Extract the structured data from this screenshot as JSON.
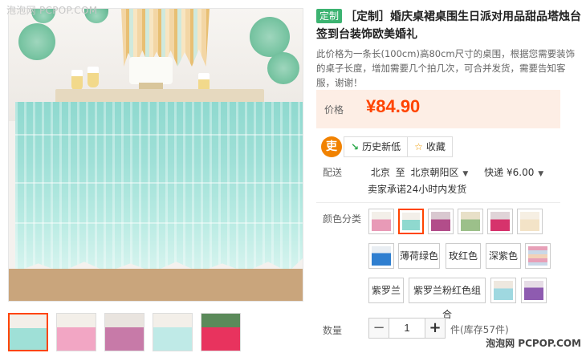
{
  "watermark_top": "泡泡网 PCPOP.COM",
  "watermark_bottom": "泡泡网 PCPOP.COM",
  "product": {
    "tag": "定制",
    "title": "［定制］婚庆桌裙桌围生日派对用品甜品塔烛台签到台装饰欧美婚礼",
    "description": "此价格为一条长(100cm)高80cm尺寸的桌围，根据您需要装饰的桌子长度，增加需要几个拍几次，可合并发货，需要告知客服，谢谢！"
  },
  "price": {
    "label": "价格",
    "value": "¥84.90"
  },
  "actions": {
    "zhi_icon_text": "吏",
    "history_label": "历史新低",
    "favorite_label": "收藏"
  },
  "shipping": {
    "label": "配送",
    "from": "北京",
    "to_word": "至",
    "to": "北京朝阳区",
    "method": "快递",
    "fee": "¥6.00",
    "promise": "卖家承诺24小时内发货"
  },
  "color": {
    "label": "颜色分类",
    "text_options": [
      "薄荷绿色",
      "玫红色",
      "深紫色",
      "紫罗兰",
      "紫罗兰粉红色组合"
    ]
  },
  "quantity": {
    "label": "数量",
    "minus": "−",
    "plus": "+",
    "value": "1",
    "stock": "件(库存57件)"
  },
  "colors": {
    "accent": "#ff4400",
    "price_bg": "#fdeee5",
    "tag_bg": "#3cb371",
    "mint": "#9fe0d7"
  }
}
